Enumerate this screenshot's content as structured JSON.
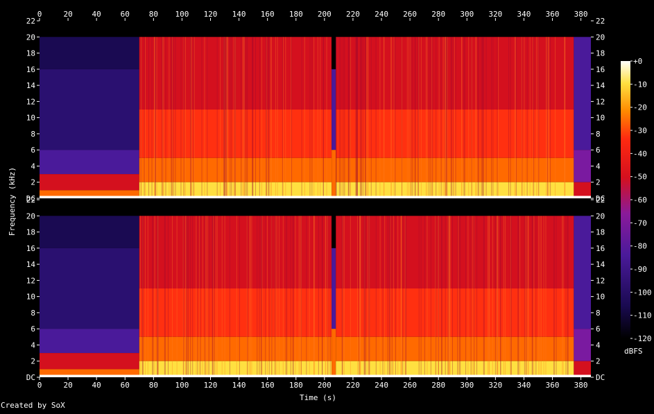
{
  "chart_data": {
    "type": "heatmap",
    "source_label": "Created by SoX",
    "xlabel": "Time (s)",
    "ylabel": "Frequency (kHz)",
    "colorbar_label": "dBFS",
    "x_ticks": [
      "0",
      "20",
      "40",
      "60",
      "80",
      "100",
      "120",
      "140",
      "160",
      "180",
      "200",
      "220",
      "240",
      "260",
      "280",
      "300",
      "320",
      "340",
      "360",
      "380"
    ],
    "xlim": [
      0,
      387
    ],
    "ylim_khz": [
      0,
      22
    ],
    "y_ticks": [
      "DC",
      "2",
      "4",
      "6",
      "8",
      "10",
      "12",
      "14",
      "16",
      "18",
      "20",
      "22"
    ],
    "colorbar_ticks": [
      "+0",
      "-10",
      "-20",
      "-30",
      "-40",
      "-50",
      "-60",
      "-70",
      "-80",
      "-90",
      "-100",
      "-110",
      "-120"
    ],
    "colorbar_range_dbfs": [
      -120,
      0
    ],
    "channels": 2,
    "colors": {
      "background": "#000000",
      "quiet": "#1a0a52",
      "low": "#4a1a9a",
      "mid": "#d4101e",
      "high": "#ff6a00",
      "peak": "#ffe040",
      "max": "#ffffff"
    },
    "segments": [
      {
        "t0": 0,
        "t1": 70,
        "level": "quiet"
      },
      {
        "t0": 70,
        "t1": 205,
        "level": "loud"
      },
      {
        "t0": 205,
        "t1": 208,
        "level": "gap"
      },
      {
        "t0": 208,
        "t1": 375,
        "level": "loud"
      },
      {
        "t0": 375,
        "t1": 387,
        "level": "fade"
      }
    ]
  }
}
